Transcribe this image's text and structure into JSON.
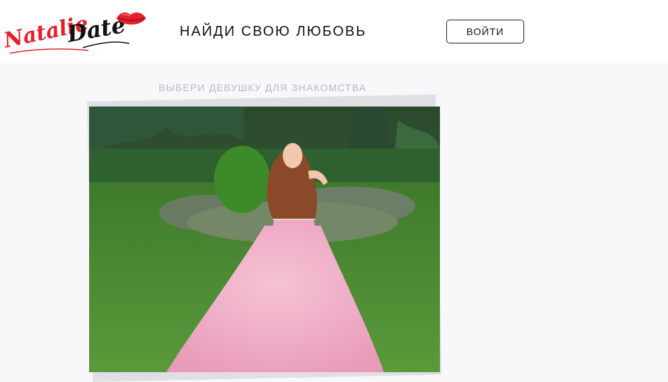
{
  "header": {
    "logo": {
      "text_part1": "Natalie",
      "text_part2": "Date",
      "icon": "lips-icon",
      "colors": {
        "red": "#e4202e",
        "dark": "#111111"
      }
    },
    "tagline": "НАЙДИ СВОЮ ЛЮБОВЬ",
    "login_button": "ВОЙТИ"
  },
  "main": {
    "section_title": "ВЫБЕРИ ДЕВУШКУ ДЛЯ ЗНАКОМСТВА",
    "profile_card": {
      "photo_icon": "profile-photo-image"
    }
  },
  "colors": {
    "page_background": "#f8f8fa",
    "header_background": "#ffffff",
    "muted_text": "#b9b9c0",
    "accent_red": "#e4202e"
  }
}
